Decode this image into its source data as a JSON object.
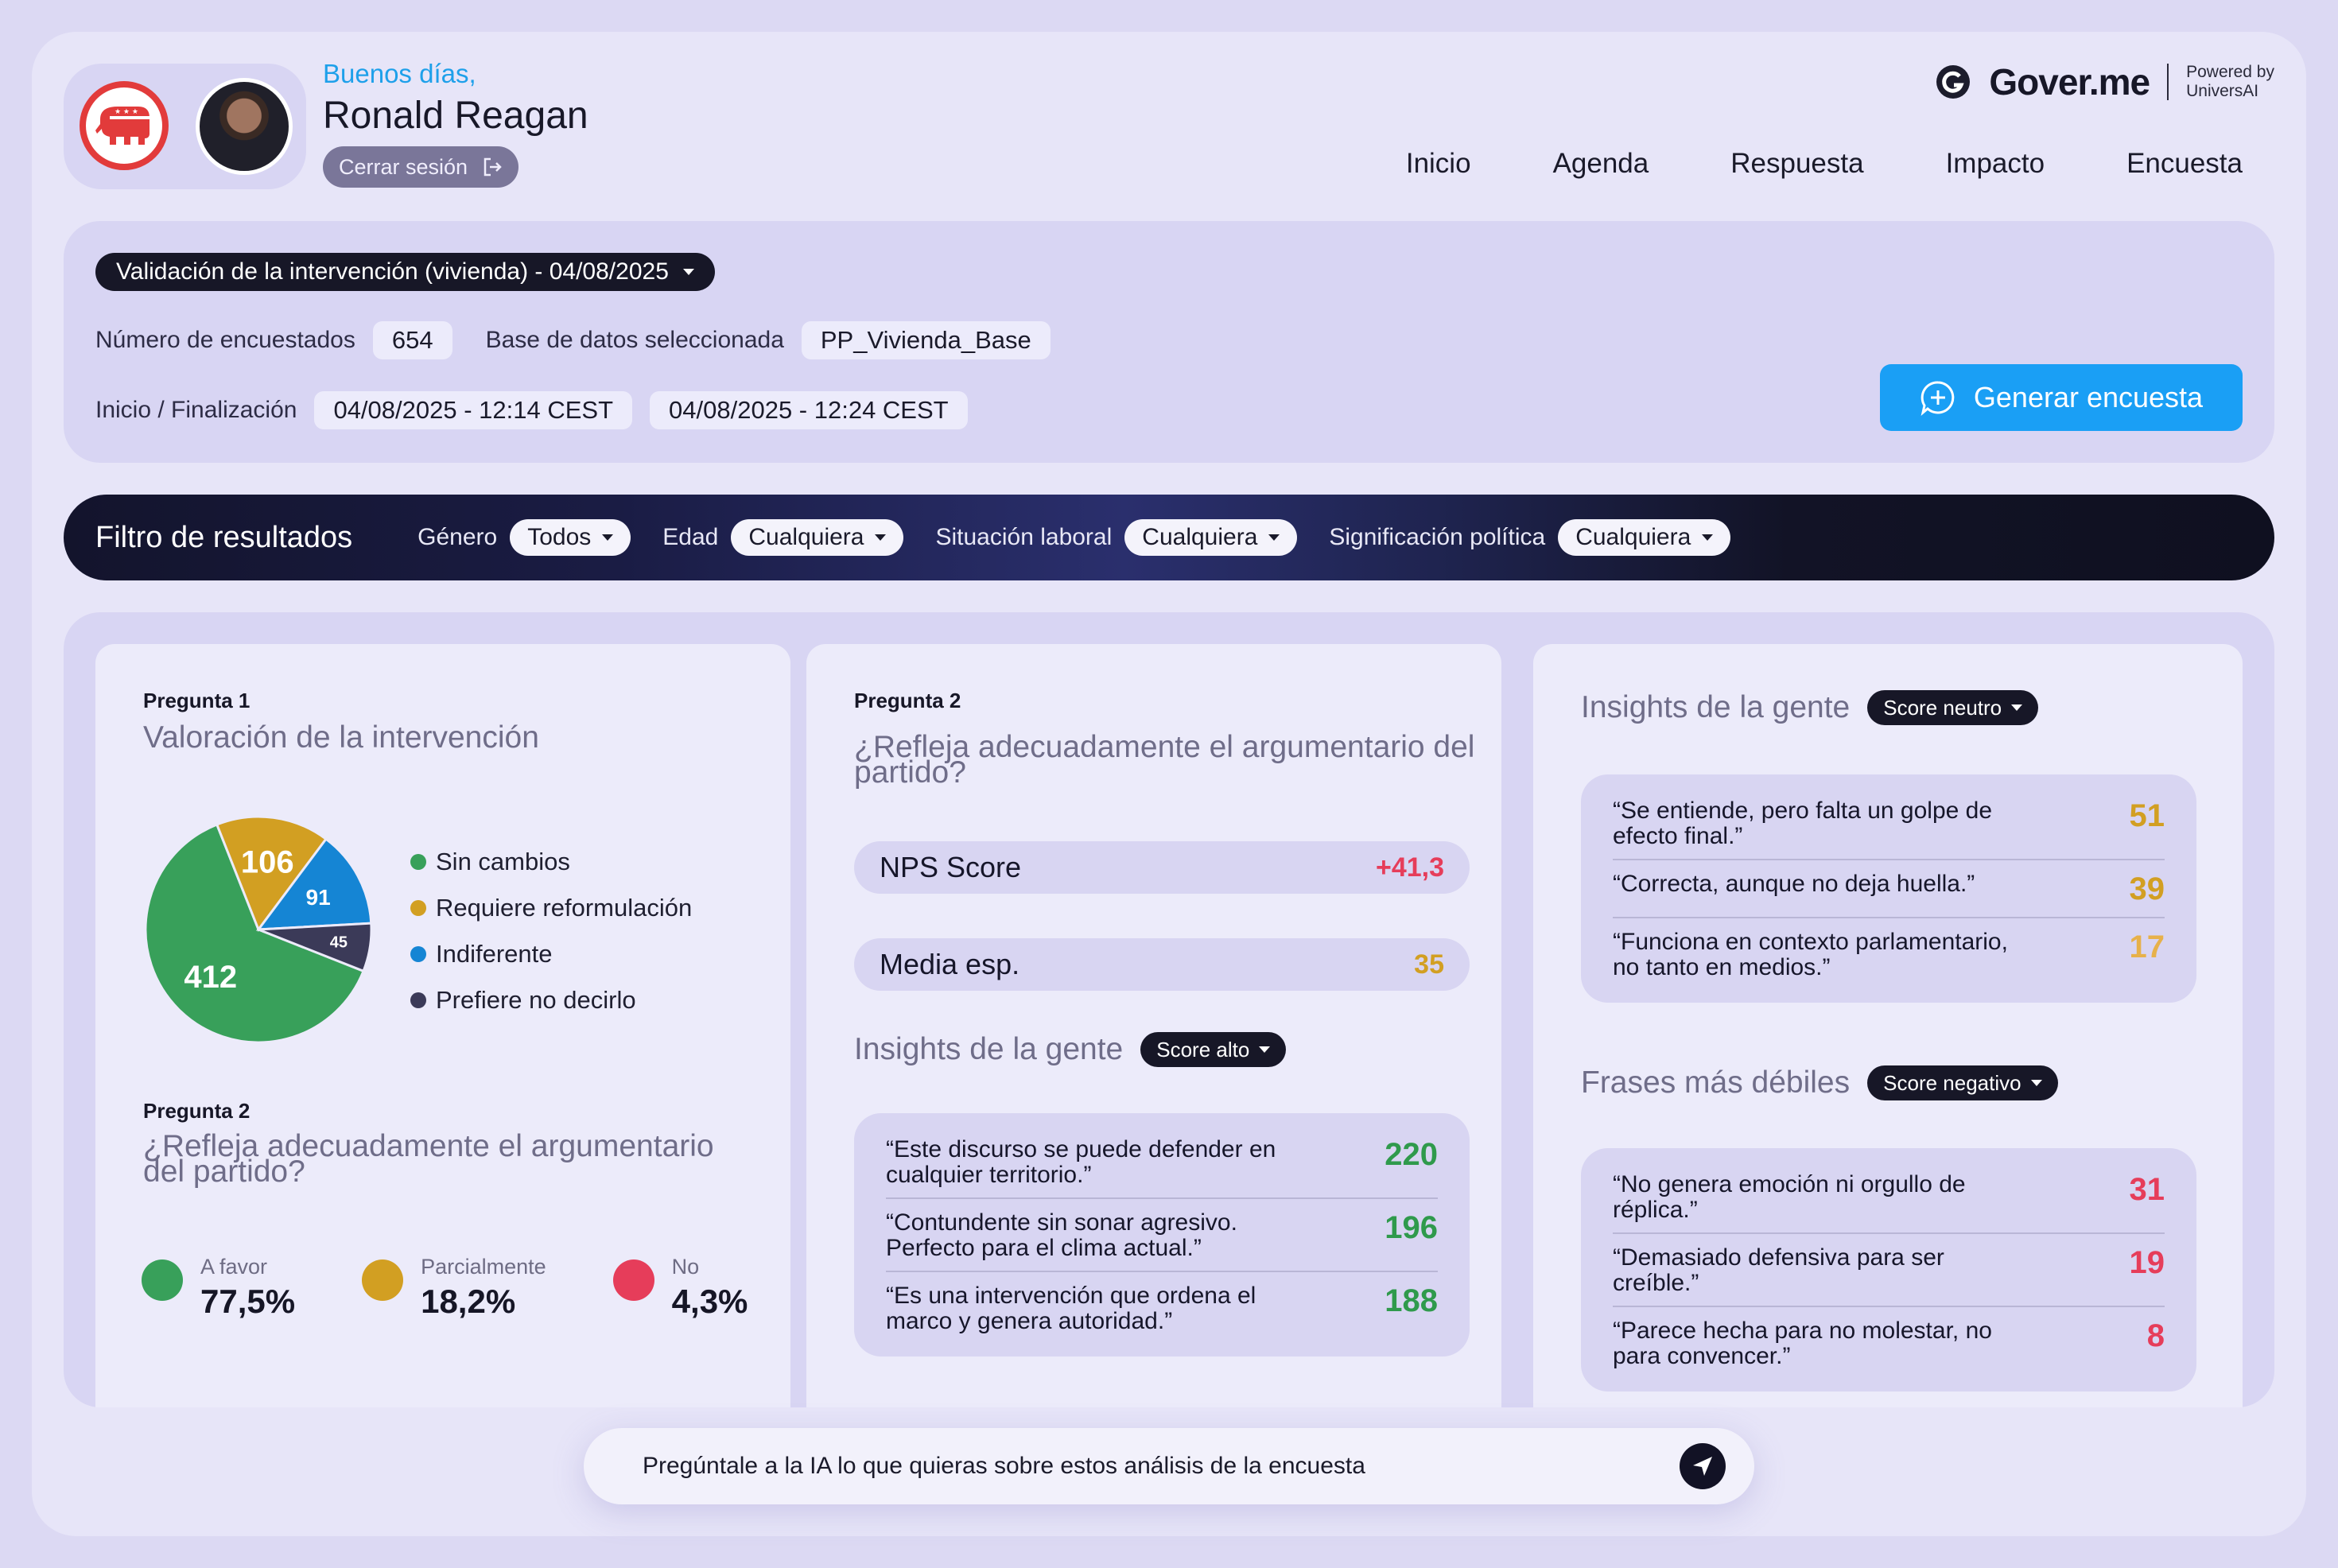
{
  "header": {
    "greeting": "Buenos días,",
    "user_name": "Ronald Reagan",
    "logout_label": "Cerrar sesión",
    "brand_name": "Gover.me",
    "powered_line1": "Powered by",
    "powered_line2": "UniversAI"
  },
  "nav": [
    "Inicio",
    "Agenda",
    "Respuesta",
    "Impacto",
    "Encuesta"
  ],
  "survey": {
    "selected": "Validación de la intervención (vivienda) - 04/08/2025",
    "respondents_label": "Número de encuestados",
    "respondents_value": "654",
    "database_label": "Base de datos seleccionada",
    "database_value": "PP_Vivienda_Base",
    "dates_label": "Inicio / Finalización",
    "start": "04/08/2025 - 12:14 CEST",
    "end": "04/08/2025 - 12:24 CEST",
    "generate_label": "Generar encuesta"
  },
  "filters": {
    "title": "Filtro de resultados",
    "items": [
      {
        "label": "Género",
        "value": "Todos"
      },
      {
        "label": "Edad",
        "value": "Cualquiera"
      },
      {
        "label": "Situación laboral",
        "value": "Cualquiera"
      },
      {
        "label": "Significación política",
        "value": "Cualquiera"
      }
    ]
  },
  "card1": {
    "q1_tag": "Pregunta 1",
    "q1_title": "Valoración de la intervención",
    "legend": [
      "Sin cambios",
      "Requiere reformulación",
      "Indiferente",
      "Prefiere no decirlo"
    ],
    "q2_tag": "Pregunta 2",
    "q2_title_line1": "¿Refleja adecuadamente el argumentario",
    "q2_title_line2": "del partido?",
    "stats": [
      {
        "label": "A favor",
        "value": "77,5%"
      },
      {
        "label": "Parcialmente",
        "value": "18,2%"
      },
      {
        "label": "No",
        "value": "4,3%"
      }
    ]
  },
  "chart_data": {
    "type": "pie",
    "categories": [
      "Sin cambios",
      "Requiere reformulación",
      "Indiferente",
      "Prefiere no decirlo"
    ],
    "values": [
      412,
      106,
      91,
      45
    ],
    "colors": [
      "#38a05a",
      "#d29f22",
      "#1585d4",
      "#3b3a58"
    ]
  },
  "card2": {
    "q_tag": "Pregunta 2",
    "q_title_line1": "¿Refleja adecuadamente el argumentario del",
    "q_title_line2": "partido?",
    "nps_label": "NPS Score",
    "nps_value": "+41,3",
    "mean_label": "Media esp.",
    "mean_value": "35",
    "insights_title": "Insights de la gente",
    "insights_pill": "Score alto",
    "quotes": [
      {
        "line1": "“Este discurso se puede defender en",
        "line2": "cualquier territorio.”",
        "num": "220"
      },
      {
        "line1": "“Contundente sin sonar agresivo.",
        "line2": "Perfecto para el clima actual.”",
        "num": "196"
      },
      {
        "line1": "“Es una intervención que ordena el",
        "line2": "marco y genera autoridad.”",
        "num": "188"
      }
    ]
  },
  "card3": {
    "insights_title": "Insights de la gente",
    "insights_pill": "Score neutro",
    "neutral_quotes": [
      {
        "line1": "“Se entiende, pero falta un golpe de",
        "line2": "efecto final.”",
        "num": "51"
      },
      {
        "line1": "“Correcta, aunque no deja huella.”",
        "line2": "",
        "num": "39"
      },
      {
        "line1": "“Funciona en contexto parlamentario,",
        "line2": "no tanto en medios.”",
        "num": "17"
      }
    ],
    "weak_title": "Frases más débiles",
    "weak_pill": "Score negativo",
    "weak_quotes": [
      {
        "line1": "“No genera emoción ni orgullo de",
        "line2": "réplica.”",
        "num": "31"
      },
      {
        "line1": "“Demasiado defensiva para ser",
        "line2": "creíble.”",
        "num": "19"
      },
      {
        "line1": "“Parece hecha para no molestar, no",
        "line2": "para convencer.”",
        "num": "8"
      }
    ]
  },
  "ai": {
    "prompt": "Pregúntale a la IA lo que quieras sobre estos análisis de la encuesta"
  },
  "colors": {
    "green": "#2f9a4c",
    "gold": "#d29f22",
    "red": "#e63d5a",
    "blue": "#1a9ff5"
  }
}
